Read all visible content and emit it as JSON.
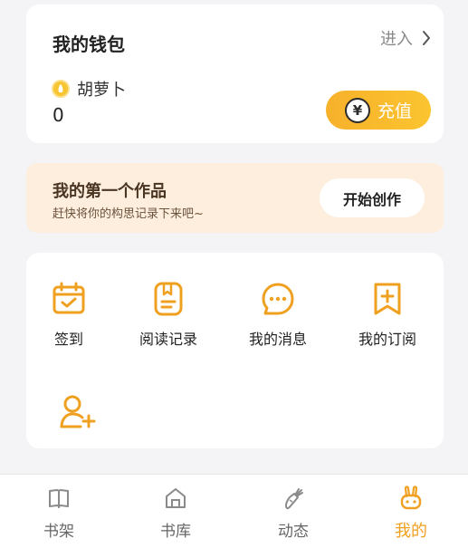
{
  "wallet": {
    "title": "我的钱包",
    "enter_label": "进入",
    "currency_name": "胡萝卜",
    "balance": "0",
    "recharge_label": "充值",
    "recharge_symbol": "¥"
  },
  "first_work": {
    "title": "我的第一个作品",
    "subtitle": "赶快将你的构思记录下来吧~",
    "button_label": "开始创作"
  },
  "functions": [
    {
      "label": "签到",
      "icon": "calendar-check-icon"
    },
    {
      "label": "阅读记录",
      "icon": "book-bookmark-icon"
    },
    {
      "label": "我的消息",
      "icon": "chat-bubble-icon"
    },
    {
      "label": "我的订阅",
      "icon": "bookmark-plus-icon"
    },
    {
      "label": "",
      "icon": "add-user-icon"
    }
  ],
  "tabbar": {
    "tabs": [
      {
        "label": "书架",
        "icon": "bookshelf-icon",
        "active": false
      },
      {
        "label": "书库",
        "icon": "library-house-icon",
        "active": false
      },
      {
        "label": "动态",
        "icon": "carrot-icon",
        "active": false
      },
      {
        "label": "我的",
        "icon": "rabbit-icon",
        "active": true
      }
    ]
  },
  "colors": {
    "accent": "#f0a020",
    "recharge_gradient_start": "#f7b12b",
    "recharge_gradient_end": "#fbc42f",
    "banner_bg": "#fdeedd",
    "page_bg": "#f4f4f6"
  }
}
